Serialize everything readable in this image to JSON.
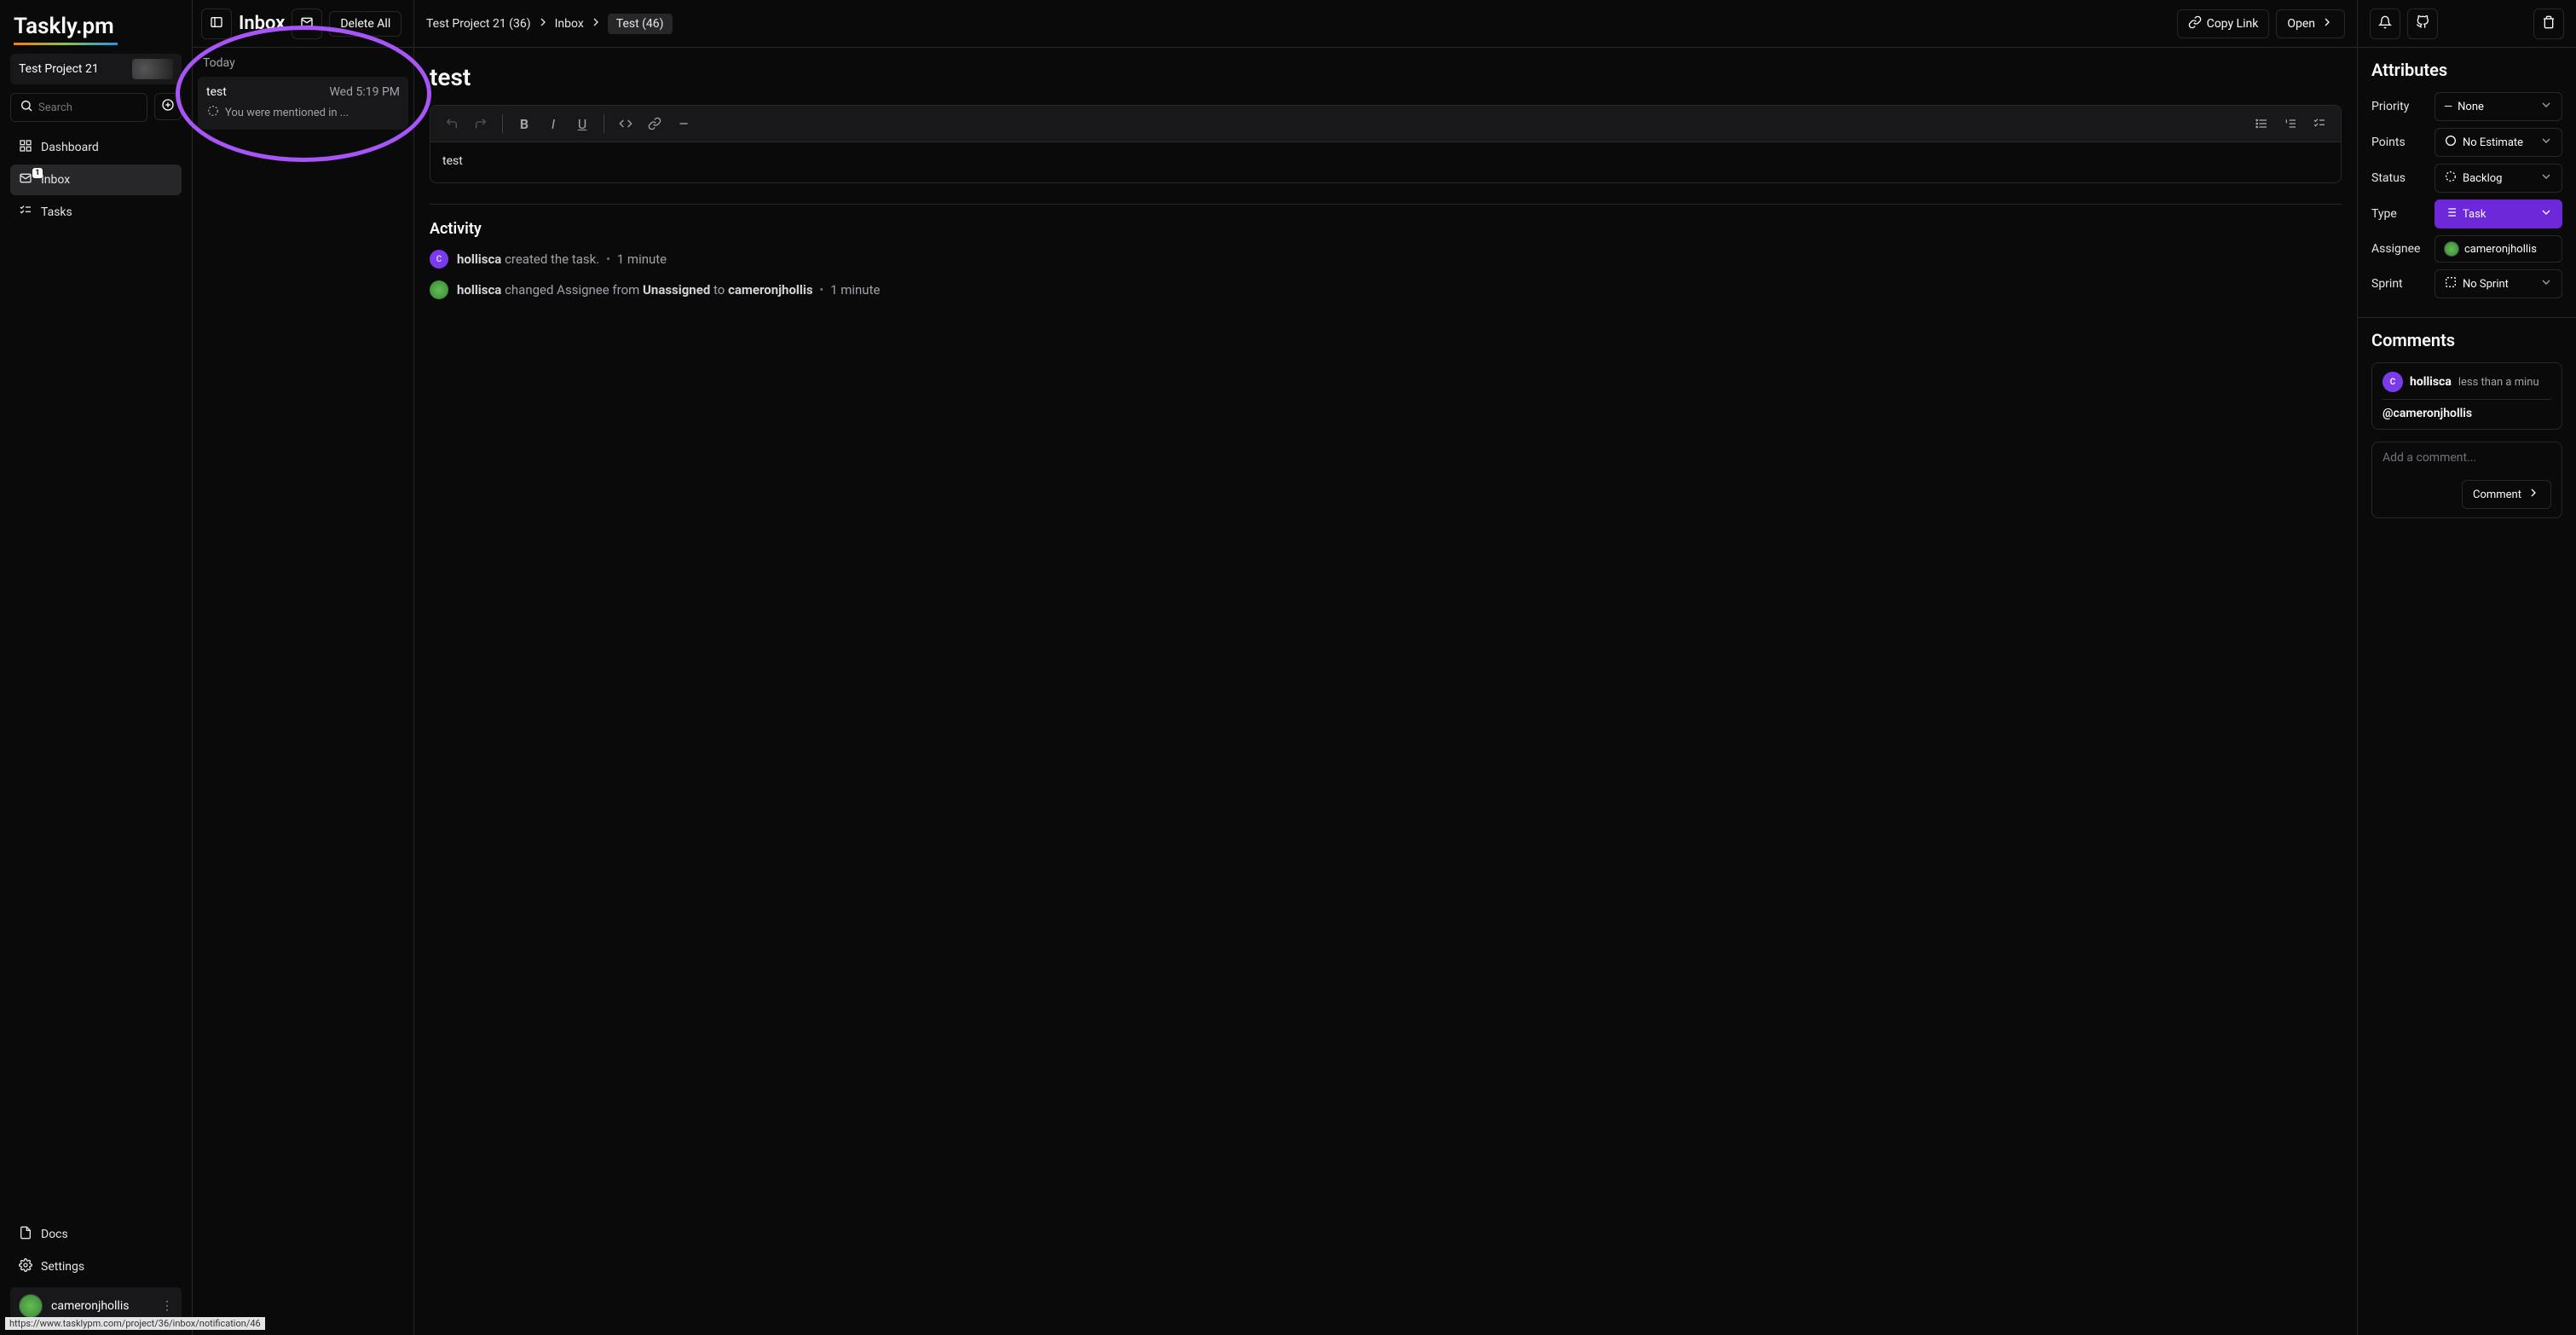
{
  "logo": "Taskly.pm",
  "project": {
    "name": "Test Project 21"
  },
  "search": {
    "placeholder": "Search"
  },
  "nav": {
    "dashboard": "Dashboard",
    "inbox": "Inbox",
    "inbox_badge": "1",
    "tasks": "Tasks",
    "docs": "Docs",
    "settings": "Settings"
  },
  "user": {
    "name": "cameronjhollis"
  },
  "url_tooltip": "https://www.tasklypm.com/project/36/inbox/notification/46",
  "inbox": {
    "title": "Inbox",
    "delete_all": "Delete All",
    "section": "Today",
    "item": {
      "title": "test",
      "time": "Wed 5:19 PM",
      "sub": "You were mentioned in ..."
    }
  },
  "breadcrumb": {
    "project": "Test Project 21 (36)",
    "inbox": "Inbox",
    "current": "Test (46)"
  },
  "header_actions": {
    "copy_link": "Copy Link",
    "open": "Open"
  },
  "task": {
    "title": "test",
    "body": "test"
  },
  "activity": {
    "heading": "Activity",
    "rows": [
      {
        "actor": "hollisca",
        "text": "created the task.",
        "time": "1 minute"
      },
      {
        "actor": "hollisca",
        "prefix": "changed Assignee from",
        "from": "Unassigned",
        "mid": "to",
        "to": "cameronjhollis",
        "time": "1 minute"
      }
    ]
  },
  "attributes": {
    "heading": "Attributes",
    "priority": {
      "label": "Priority",
      "value": "None"
    },
    "points": {
      "label": "Points",
      "value": "No Estimate"
    },
    "status": {
      "label": "Status",
      "value": "Backlog"
    },
    "type": {
      "label": "Type",
      "value": "Task"
    },
    "assignee": {
      "label": "Assignee",
      "value": "cameronjhollis"
    },
    "sprint": {
      "label": "Sprint",
      "value": "No Sprint"
    }
  },
  "comments": {
    "heading": "Comments",
    "item": {
      "author": "hollisca",
      "time": "less than a minu",
      "body": "@cameronjhollis"
    },
    "placeholder": "Add a comment...",
    "submit": "Comment"
  }
}
